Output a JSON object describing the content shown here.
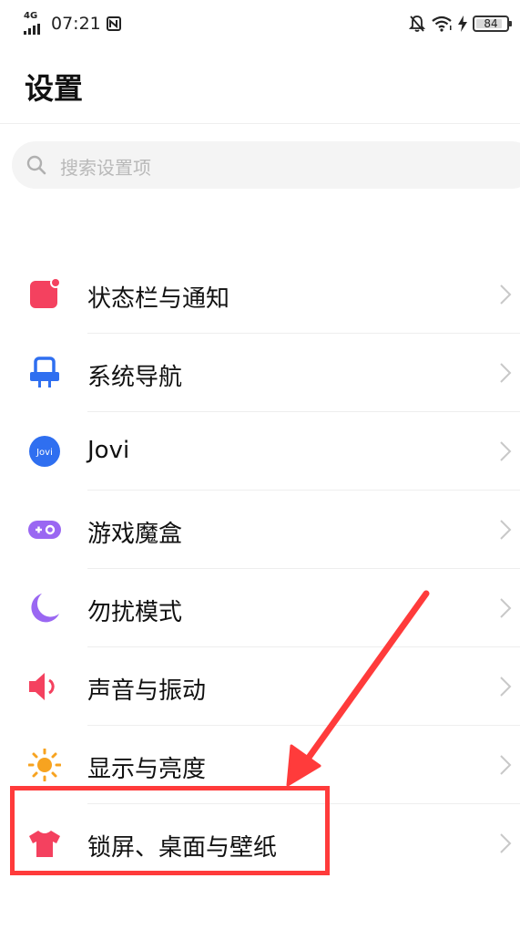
{
  "status_bar": {
    "network": "4G",
    "time": "07:21",
    "battery": "84"
  },
  "header": {
    "title": "设置"
  },
  "search": {
    "placeholder": "搜索设置项"
  },
  "items": [
    {
      "label": "状态栏与通知",
      "icon": "status-bar-notification-icon",
      "color": "#f4415f"
    },
    {
      "label": "系统导航",
      "icon": "system-navigation-icon",
      "color": "#2f6ff0"
    },
    {
      "label": "Jovi",
      "icon": "jovi-icon",
      "color": "#2f6ff0"
    },
    {
      "label": "游戏魔盒",
      "icon": "game-box-icon",
      "color": "#9a67f2"
    },
    {
      "label": "勿扰模式",
      "icon": "do-not-disturb-moon-icon",
      "color": "#9a67f2"
    },
    {
      "label": "声音与振动",
      "icon": "sound-vibration-icon",
      "color": "#f4415f"
    },
    {
      "label": "显示与亮度",
      "icon": "display-brightness-sun-icon",
      "color": "#f7a320"
    },
    {
      "label": "锁屏、桌面与壁纸",
      "icon": "lockscreen-wallpaper-shirt-icon",
      "color": "#f4415f"
    }
  ],
  "annotation": {
    "color": "#ff3b3b"
  }
}
